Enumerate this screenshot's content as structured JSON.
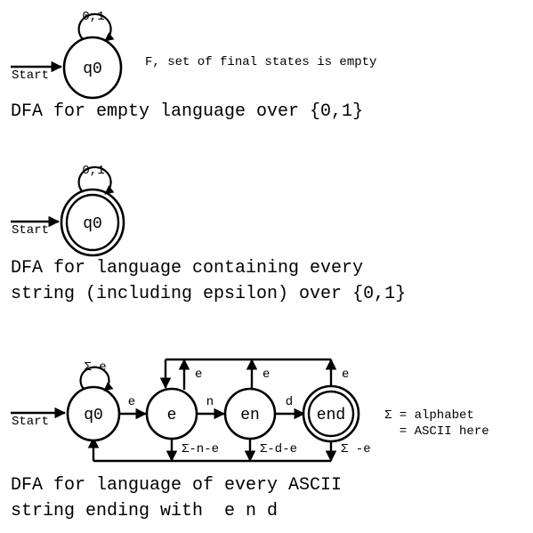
{
  "page": {
    "background": "#ffffff",
    "ink": "#000000"
  },
  "diagrams": [
    {
      "id": "dfa-empty-language",
      "start_label": "Start",
      "states": [
        {
          "name": "q0",
          "label": "q0",
          "accepting": false
        }
      ],
      "self_loop_label": "0,1",
      "note": "F, set of final states is empty",
      "caption_lines": [
        "DFA for empty language over {0,1}"
      ]
    },
    {
      "id": "dfa-all-strings",
      "start_label": "Start",
      "states": [
        {
          "name": "q0",
          "label": "q0",
          "accepting": true
        }
      ],
      "self_loop_label": "0,1",
      "note": "",
      "caption_lines": [
        "DFA for language containing every",
        "string (including epsilon) over {0,1}"
      ]
    },
    {
      "id": "dfa-ending-end",
      "start_label": "Start",
      "states": [
        {
          "name": "q0",
          "label": "q0",
          "accepting": false
        },
        {
          "name": "e",
          "label": "e",
          "accepting": false
        },
        {
          "name": "en",
          "label": "en",
          "accepting": false
        },
        {
          "name": "end",
          "label": "end",
          "accepting": true
        }
      ],
      "self_loop_label": "Σ-e",
      "forward_labels": [
        "e",
        "n",
        "d"
      ],
      "up_bus_labels": [
        "e",
        "e",
        "e"
      ],
      "down_bus_labels": [
        "Σ-n-e",
        "Σ-d-e",
        "Σ -e"
      ],
      "legend_lines": [
        "Σ = alphabet",
        "  = ASCII here"
      ],
      "caption_lines": [
        "DFA for language of every ASCII",
        "string ending with  e n d"
      ]
    }
  ]
}
